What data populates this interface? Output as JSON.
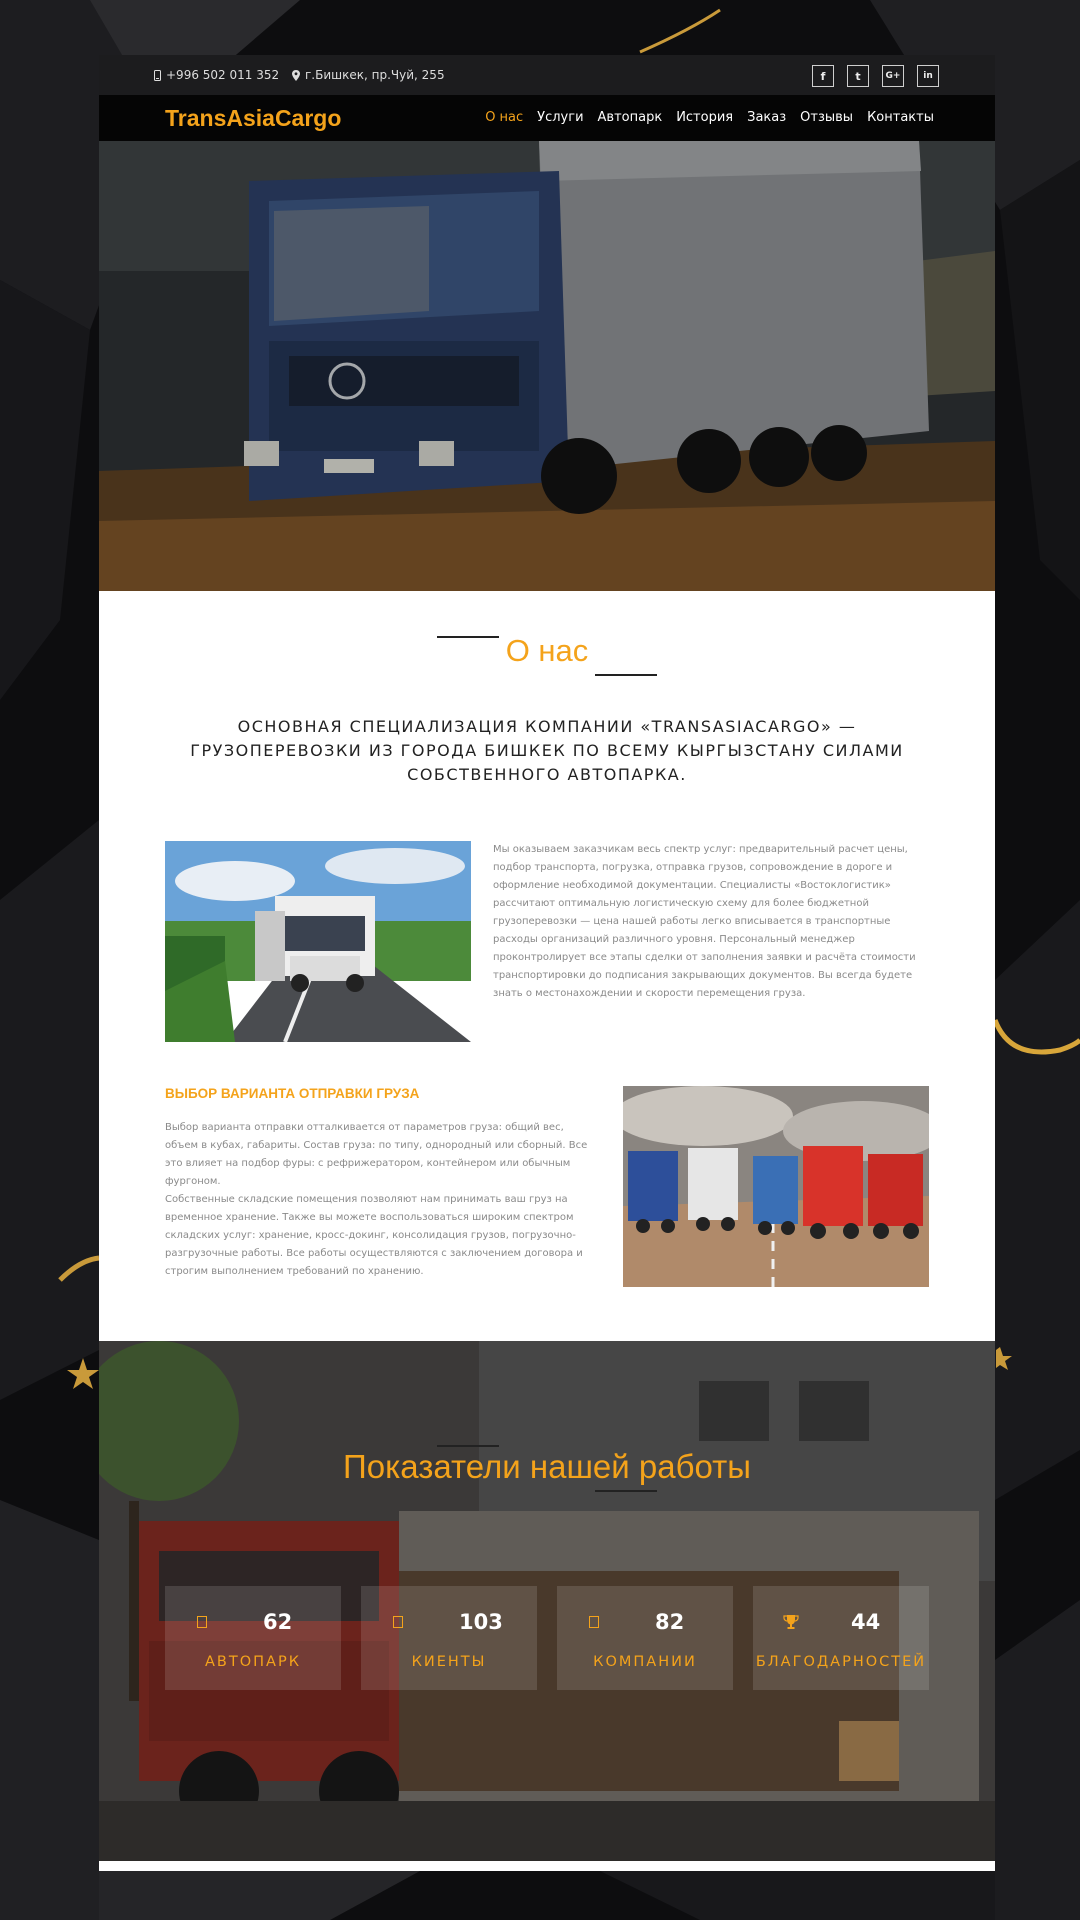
{
  "topbar": {
    "phone": "+996 502 011 352",
    "address": "г.Бишкек, пр.Чуй, 255",
    "social": [
      {
        "icon": "facebook-icon",
        "glyph": "f"
      },
      {
        "icon": "twitter-icon",
        "glyph": "t"
      },
      {
        "icon": "google-plus-icon",
        "glyph": "G+"
      },
      {
        "icon": "linkedin-icon",
        "glyph": "in"
      }
    ]
  },
  "brand": {
    "logo": "TransAsiaCargo",
    "accent_color": "#f4a31b"
  },
  "nav": {
    "items": [
      "О нас",
      "Услуги",
      "Автопарк",
      "История",
      "Заказ",
      "Отзывы",
      "Контакты"
    ],
    "active": "О нас"
  },
  "hero": {
    "image": "blue-truck-on-road"
  },
  "about": {
    "title": "О нас",
    "lead": "ОСНОВНАЯ СПЕЦИАЛИЗАЦИЯ КОМПАНИИ «TRANSASIACARGO» — ГРУЗОПЕРЕВОЗКИ ИЗ ГОРОДА БИШКЕК ПО ВСЕМУ КЫРГЫЗСТАНУ СИЛАМИ СОБСТВЕННОГО АВТОПАРКА.",
    "paragraph": "Мы оказываем заказчикам весь спектр услуг: предварительный расчет цены, подбор транспорта, погрузка, отправка грузов, сопровождение в дороге и оформление необходимой документации. Специалисты «Востоклогистик» рассчитают оптимальную логистическую схему для более бюджетной грузоперевозки — цена нашей работы легко вписывается в транспортные расходы организаций различного уровня. Персональный менеджер проконтролирует все этапы сделки от заполнения заявки и расчёта стоимости транспортировки до подписания закрывающих документов. Вы всегда будете знать о местонахождении и скорости перемещения груза.",
    "shipping": {
      "heading": "ВЫБОР ВАРИАНТА ОТПРАВКИ ГРУЗА",
      "p1": "Выбор варианта отправки отталкивается от параметров груза: общий вес, объем в кубах, габариты. Состав груза: по типу, однородный или сборный. Все это влияет на подбор фуры: с рефрижератором, контейнером или обычным фургоном.",
      "p2": "Собственные складские помещения позволяют нам принимать ваш груз на временное хранение. Также вы можете воспользоваться широким спектром складских услуг: хранение, кросс-докинг, консолидация грузов, погрузочно-разгрузочные работы. Все работы осуществляются с заключением договора и строгим выполнением требований по хранению."
    }
  },
  "stats": {
    "title": "Показатели нашей работы",
    "items": [
      {
        "value": "62",
        "label": "АВТОПАРК",
        "icon": "truck-icon"
      },
      {
        "value": "103",
        "label": "КИЕНТЫ",
        "icon": "users-icon"
      },
      {
        "value": "82",
        "label": "КОМПАНИИ",
        "icon": "building-icon"
      },
      {
        "value": "44",
        "label": "БЛАГОДАРНОСТЕЙ",
        "icon": "trophy-icon"
      }
    ]
  }
}
